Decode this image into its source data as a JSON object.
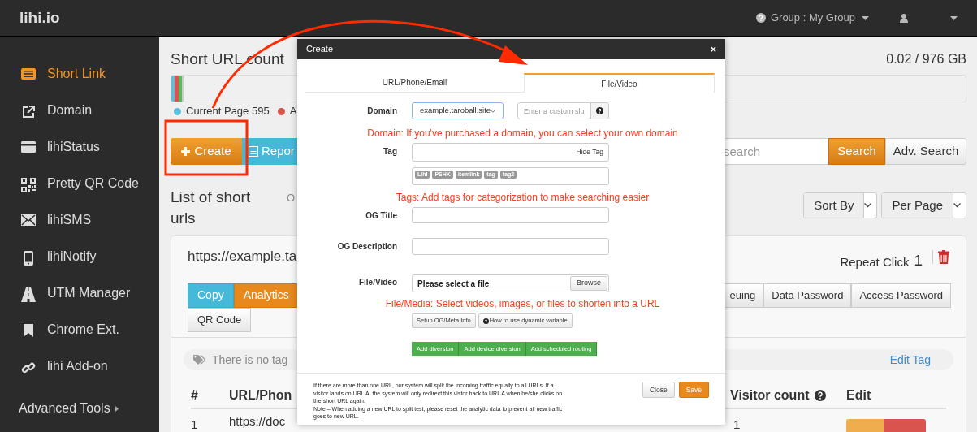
{
  "header": {
    "logo": "lihi.io",
    "group": "Group : My Group"
  },
  "sidebar": {
    "items": [
      {
        "label": "Short Link",
        "selected": true
      },
      {
        "label": "Domain",
        "selected": false
      },
      {
        "label": "lihiStatus",
        "selected": false
      },
      {
        "label": "Pretty QR Code",
        "selected": false
      },
      {
        "label": "lihiSMS",
        "selected": false
      },
      {
        "label": "lihiNotify",
        "selected": false
      },
      {
        "label": "UTM Manager",
        "selected": false
      },
      {
        "label": "Chrome Ext.",
        "selected": false
      },
      {
        "label": "lihi Add-on",
        "selected": false
      }
    ],
    "advanced": "Advanced Tools"
  },
  "main": {
    "title": "Short URL count",
    "storage": "0.02 / 976 GB",
    "legend": [
      {
        "label": "Current Page 595",
        "color": "#5bc0de"
      },
      {
        "label": "A",
        "color": "#d9534f"
      }
    ],
    "create": "Create",
    "report": "Repor",
    "search": {
      "placeholder": "search",
      "button": "Search",
      "advanced": "Adv. Search"
    },
    "list_title": "List of short urls",
    "list_note": "O",
    "sort": [
      "Sort By",
      "Per Page"
    ],
    "card": {
      "url": "https://example.ta",
      "repeat_label": "Repeat Click",
      "repeat_count": "1",
      "left_actions": [
        {
          "label": "Copy",
          "kind": "info"
        },
        {
          "label": "Analytics",
          "kind": "warning"
        }
      ],
      "right_actions": [
        "euing",
        "Data Password",
        "Access Password"
      ],
      "qr": "QR Code",
      "tag_note": "There is no tag",
      "edit_tag": "Edit Tag"
    },
    "table": {
      "columns": [
        "#",
        "URL/Phon",
        "Visitor count",
        "Edit"
      ],
      "rows": [
        {
          "index": "1",
          "url": "https://doc",
          "visitors": "1"
        }
      ]
    }
  },
  "modal": {
    "title": "Create",
    "close": "×",
    "tabs": [
      {
        "label": "URL/Phone/Email",
        "selected": false
      },
      {
        "label": "File/Video",
        "selected": true
      }
    ],
    "domain": {
      "label": "Domain",
      "value": "example.taroball.site",
      "slug_placeholder": "Enter a custom slu"
    },
    "domain_note": "Domain: If you've purchased a domain, you can select your own domain",
    "tag": {
      "label": "Tag",
      "hide": "Hide Tag",
      "tags": [
        "LihI",
        "PSHK",
        "itemlink",
        "tag",
        "tag2"
      ]
    },
    "tag_note": "Tags: Add tags for categorization to make searching easier",
    "og_title": "OG Title",
    "og_description": "OG Description",
    "file": {
      "label": "File/Video",
      "value": "Please select a file",
      "browse": "Browse"
    },
    "file_note": "File/Media: Select videos, images, or files to shorten into a URL",
    "tools": [
      "Setup OG/Meta Info",
      "How to use dynamic variable"
    ],
    "routing": [
      "Add diversion",
      "Add device diversion",
      "Add scheduled routing"
    ],
    "footer_notes": [
      "If there are more than one URL, our system will split the incoming traffic equally to all URLs. If a visitor lands on URL A, the system will only redirect this vistor back to URL A when he/she clicks on the short URL again.",
      "Note – When adding a new URL to split test, please reset the analytic data to prevent all new traffic goes to new URL."
    ],
    "buttons": {
      "close": "Close",
      "save": "Save"
    }
  }
}
